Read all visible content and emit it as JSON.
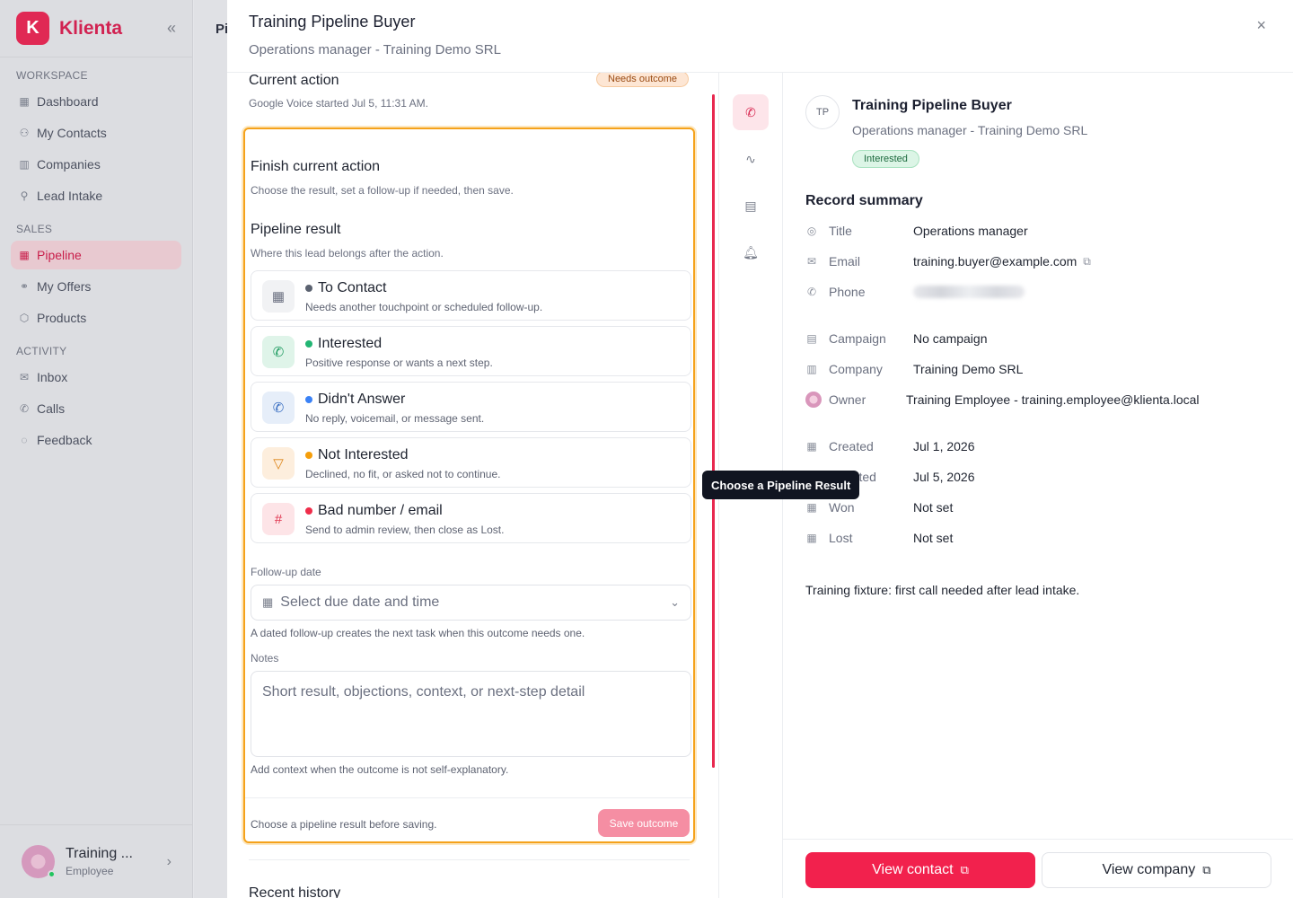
{
  "sidebar": {
    "logo_letter": "K",
    "brand": "Klienta",
    "collapse_icon": "«",
    "sections": {
      "workspace": "WORKSPACE",
      "sales": "SALES",
      "activity": "ACTIVITY"
    },
    "items": [
      {
        "label": "Dashboard",
        "icon": "grid-icon"
      },
      {
        "label": "My Contacts",
        "icon": "users-icon"
      },
      {
        "label": "Companies",
        "icon": "building-icon"
      },
      {
        "label": "Lead Intake",
        "icon": "user-plus-icon"
      },
      {
        "label": "Pipeline",
        "icon": "kanban-icon"
      },
      {
        "label": "My Offers",
        "icon": "handshake-icon"
      },
      {
        "label": "Products",
        "icon": "box-icon"
      },
      {
        "label": "Inbox",
        "icon": "mail-icon"
      },
      {
        "label": "Calls",
        "icon": "phone-icon"
      },
      {
        "label": "Feedback",
        "icon": "chat-icon"
      }
    ],
    "user": {
      "name": "Training ...",
      "role": "Employee"
    }
  },
  "background": {
    "title_fragment": "Pi"
  },
  "panel": {
    "title": "Training Pipeline Buyer",
    "subtitle": "Operations manager - Training Demo SRL",
    "close": "×"
  },
  "current_action": {
    "title": "Current action",
    "badge": "Needs outcome",
    "detail": "Google Voice started Jul 5, 11:31 AM."
  },
  "finish": {
    "title": "Finish current action",
    "subtitle": "Choose the result, set a follow-up if needed, then save.",
    "pipeline_title": "Pipeline result",
    "pipeline_subtitle": "Where this lead belongs after the action.",
    "options": [
      {
        "label": "To Contact",
        "desc": "Needs another touchpoint or scheduled follow-up.",
        "icon": "calendar-icon",
        "glyph": "▦",
        "dot": "#5b6270",
        "icon_bg": "#f1f2f4",
        "icon_color": "#6b7080"
      },
      {
        "label": "Interested",
        "desc": "Positive response or wants a next step.",
        "icon": "phone-call-icon",
        "glyph": "✆",
        "dot": "#22b573",
        "icon_bg": "#dff4e9",
        "icon_color": "#1e9b60"
      },
      {
        "label": "Didn't Answer",
        "desc": "No reply, voicemail, or message sent.",
        "icon": "phone-missed-icon",
        "glyph": "✆",
        "dot": "#3b82f6",
        "icon_bg": "#e6eef9",
        "icon_color": "#3a6fc2"
      },
      {
        "label": "Not Interested",
        "desc": "Declined, no fit, or asked not to continue.",
        "icon": "thumbs-down-icon",
        "glyph": "▽",
        "dot": "#f59e0b",
        "icon_bg": "#fdeedd",
        "icon_color": "#dd8417"
      },
      {
        "label": "Bad number / email",
        "desc": "Send to admin review, then close as Lost.",
        "icon": "hash-icon",
        "glyph": "#",
        "dot": "#ef2d4a",
        "icon_bg": "#fde4e7",
        "icon_color": "#e0354f"
      }
    ],
    "followup_label": "Follow-up date",
    "followup_placeholder": "Select due date and time",
    "followup_help": "A dated follow-up creates the next task when this outcome needs one.",
    "notes_label": "Notes",
    "notes_placeholder": "Short result, objections, context, or next-step detail",
    "notes_help": "Add context when the outcome is not self-explanatory.",
    "footer_msg": "Choose a pipeline result before saving.",
    "save_label": "Save outcome"
  },
  "recent_history": "Recent history",
  "rail": {
    "buttons": [
      {
        "icon": "phone-call-icon",
        "glyph": "✆"
      },
      {
        "icon": "activity-icon",
        "glyph": "∿"
      },
      {
        "icon": "document-icon",
        "glyph": "▤"
      },
      {
        "icon": "bell-icon",
        "glyph": "♫"
      }
    ]
  },
  "tooltip": "Choose a Pipeline Result",
  "record": {
    "initials": "TP",
    "name": "Training Pipeline Buyer",
    "subtitle": "Operations manager - Training Demo SRL",
    "status": "Interested",
    "summary_title": "Record summary",
    "rows": [
      {
        "key": "Title",
        "value": "Operations manager",
        "icon": "user-circle-icon",
        "glyph": "◎"
      },
      {
        "key": "Email",
        "value": "training.buyer@example.com",
        "icon": "mail-icon",
        "glyph": "✉"
      },
      {
        "key": "Phone",
        "value": "",
        "icon": "phone-icon",
        "glyph": "✆"
      },
      {
        "key": "Campaign",
        "value": "No campaign",
        "icon": "file-icon",
        "glyph": "▤"
      },
      {
        "key": "Company",
        "value": "Training Demo SRL",
        "icon": "building-icon",
        "glyph": "▥"
      },
      {
        "key": "Owner",
        "value": "Training Employee - training.employee@klienta.local",
        "icon": "owner-avatar",
        "glyph": ""
      },
      {
        "key": "Created",
        "value": "Jul 1, 2026",
        "icon": "calendar-icon",
        "glyph": "▦"
      },
      {
        "key": "Updated",
        "value": "Jul 5, 2026",
        "icon": "calendar-icon",
        "glyph": "▦"
      },
      {
        "key": "Won",
        "value": "Not set",
        "icon": "calendar-icon",
        "glyph": "▦"
      },
      {
        "key": "Lost",
        "value": "Not set",
        "icon": "calendar-icon",
        "glyph": "▦"
      }
    ],
    "fixture_note": "Training fixture: first call needed after lead intake.",
    "view_contact": "View contact",
    "view_company": "View company"
  }
}
